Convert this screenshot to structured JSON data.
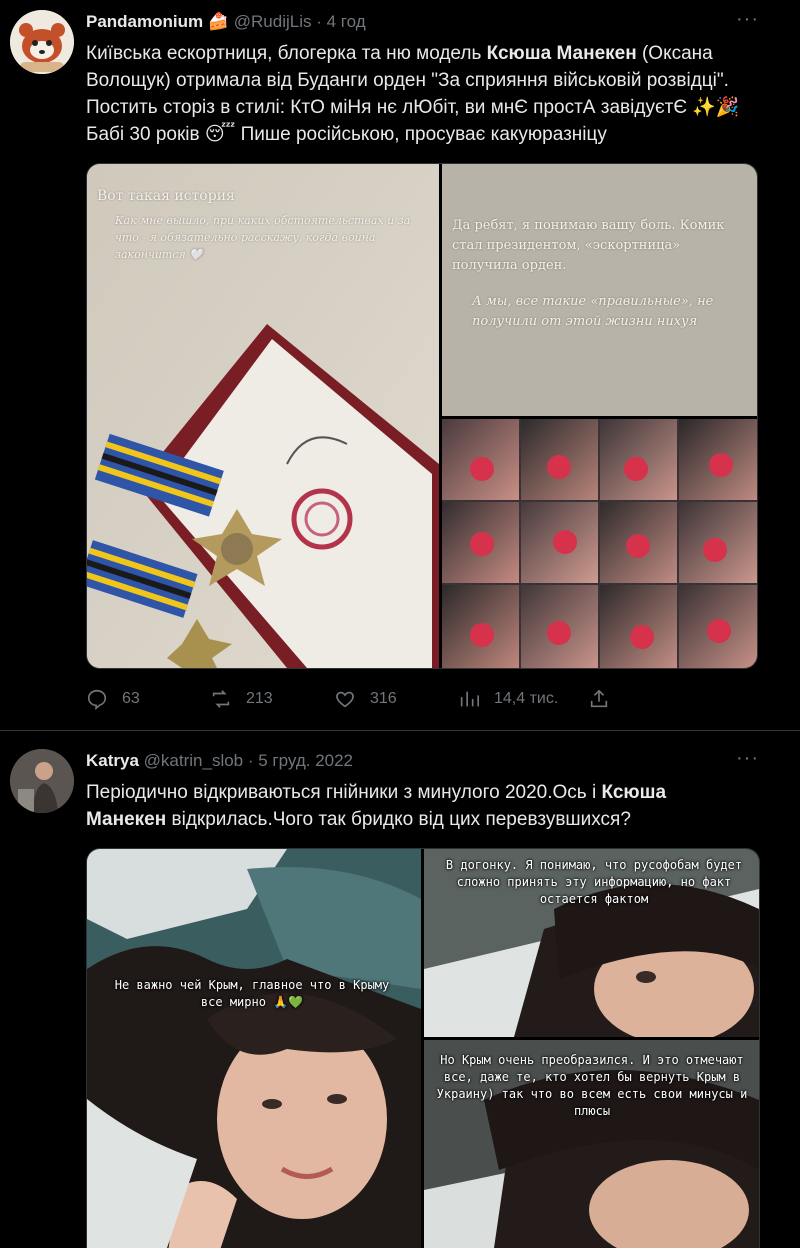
{
  "tweet1": {
    "name": "Pandamonium",
    "name_emoji": "🍰",
    "handle": "@RudijLis",
    "time": "4 год",
    "text_pre": "Київська ескортниця, блогерка та ню модель ",
    "text_bold": "Ксюша Манекен",
    "text_post": " (Оксана Волощук) отримала від Буданги орден \"За сприяння військовій розвідці\".\nПостить сторіз в стилі: КтО міНя нє лЮбіт, ви мнЄ простА завідуєтЄ ✨🎉\nБабі 30 років 😴 Пише російською, просуває какуюразніцу",
    "story_left_title": "Вот такая история",
    "story_left_body": "Как мне вышло, при каких обстоятельствах и за что - я обязательно расскажу, когда война закончится 🤍",
    "story_right_1": "Да ребят, я понимаю вашу боль. Комик стал президентом, «эскортница» получила орден.",
    "story_right_2": "А мы, все такие «правильные», не получили от этой жизни нихуя",
    "stats": {
      "replies": "63",
      "retweets": "213",
      "likes": "316",
      "views": "14,4 тис."
    }
  },
  "tweet2": {
    "name": "Katrya",
    "handle": "@katrin_slob",
    "time": "5 груд. 2022",
    "text_pre": "Періодично відкриваються гнійники з минулого 2020.Ось і ",
    "text_bold": "Ксюша\nМанекен",
    "text_post": " відкрилась.Чого так бридко від цих перевзувшихся?",
    "story_a": "Не важно чей Крым, главное что в Крыму все мирно 🙏💚",
    "story_b": "В догонку. Я понимаю, что русофобам будет сложно принять эту информацию, но факт остается фактом",
    "story_c": "Но Крым очень преобразился. И это отмечают все, даже те, кто хотел бы вернуть Крым в Украину) так что во всем есть свои минусы и плюсы"
  },
  "colors": {
    "background": "#000000",
    "text": "#e7e9ea",
    "muted": "#71767b",
    "border": "#2f3336"
  },
  "icons": [
    "more-icon",
    "reply-icon",
    "retweet-icon",
    "like-icon",
    "views-icon",
    "share-icon"
  ]
}
